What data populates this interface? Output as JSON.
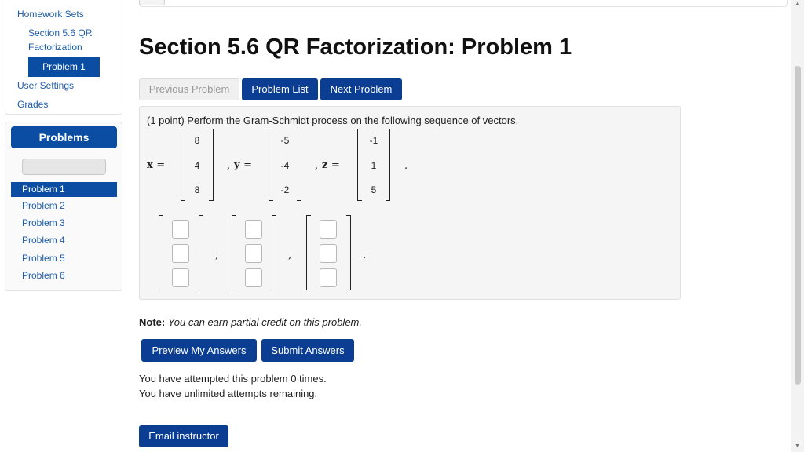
{
  "sidebar": {
    "homework_sets": "Homework Sets",
    "section": "Section 5.6 QR Factorization",
    "problem_active": "Problem 1",
    "user_settings": "User Settings",
    "grades": "Grades"
  },
  "problems_panel": {
    "header": "Problems",
    "items": [
      "Problem 1",
      "Problem 2",
      "Problem 3",
      "Problem 4",
      "Problem 5",
      "Problem 6"
    ]
  },
  "main": {
    "title": "Section 5.6 QR Factorization: Problem 1",
    "buttons": {
      "previous": "Previous Problem",
      "list": "Problem List",
      "next": "Next Problem"
    },
    "problem": {
      "statement": "(1 point) Perform the Gram-Schmidt process on the following sequence of vectors.",
      "vectors": [
        {
          "name": "x",
          "values": [
            "8",
            "4",
            "8"
          ]
        },
        {
          "name": "y",
          "values": [
            "-5",
            "-4",
            "-2"
          ]
        },
        {
          "name": "z",
          "values": [
            "-1",
            "1",
            "5"
          ]
        }
      ],
      "eq_sign": "=",
      "comma": ",",
      "period": "."
    },
    "note_label": "Note:",
    "note_text": "You can earn partial credit on this problem.",
    "preview_button": "Preview My Answers",
    "submit_button": "Submit Answers",
    "attempted": "You have attempted this problem 0 times.",
    "remaining": "You have unlimited attempts remaining.",
    "email_button": "Email instructor"
  }
}
